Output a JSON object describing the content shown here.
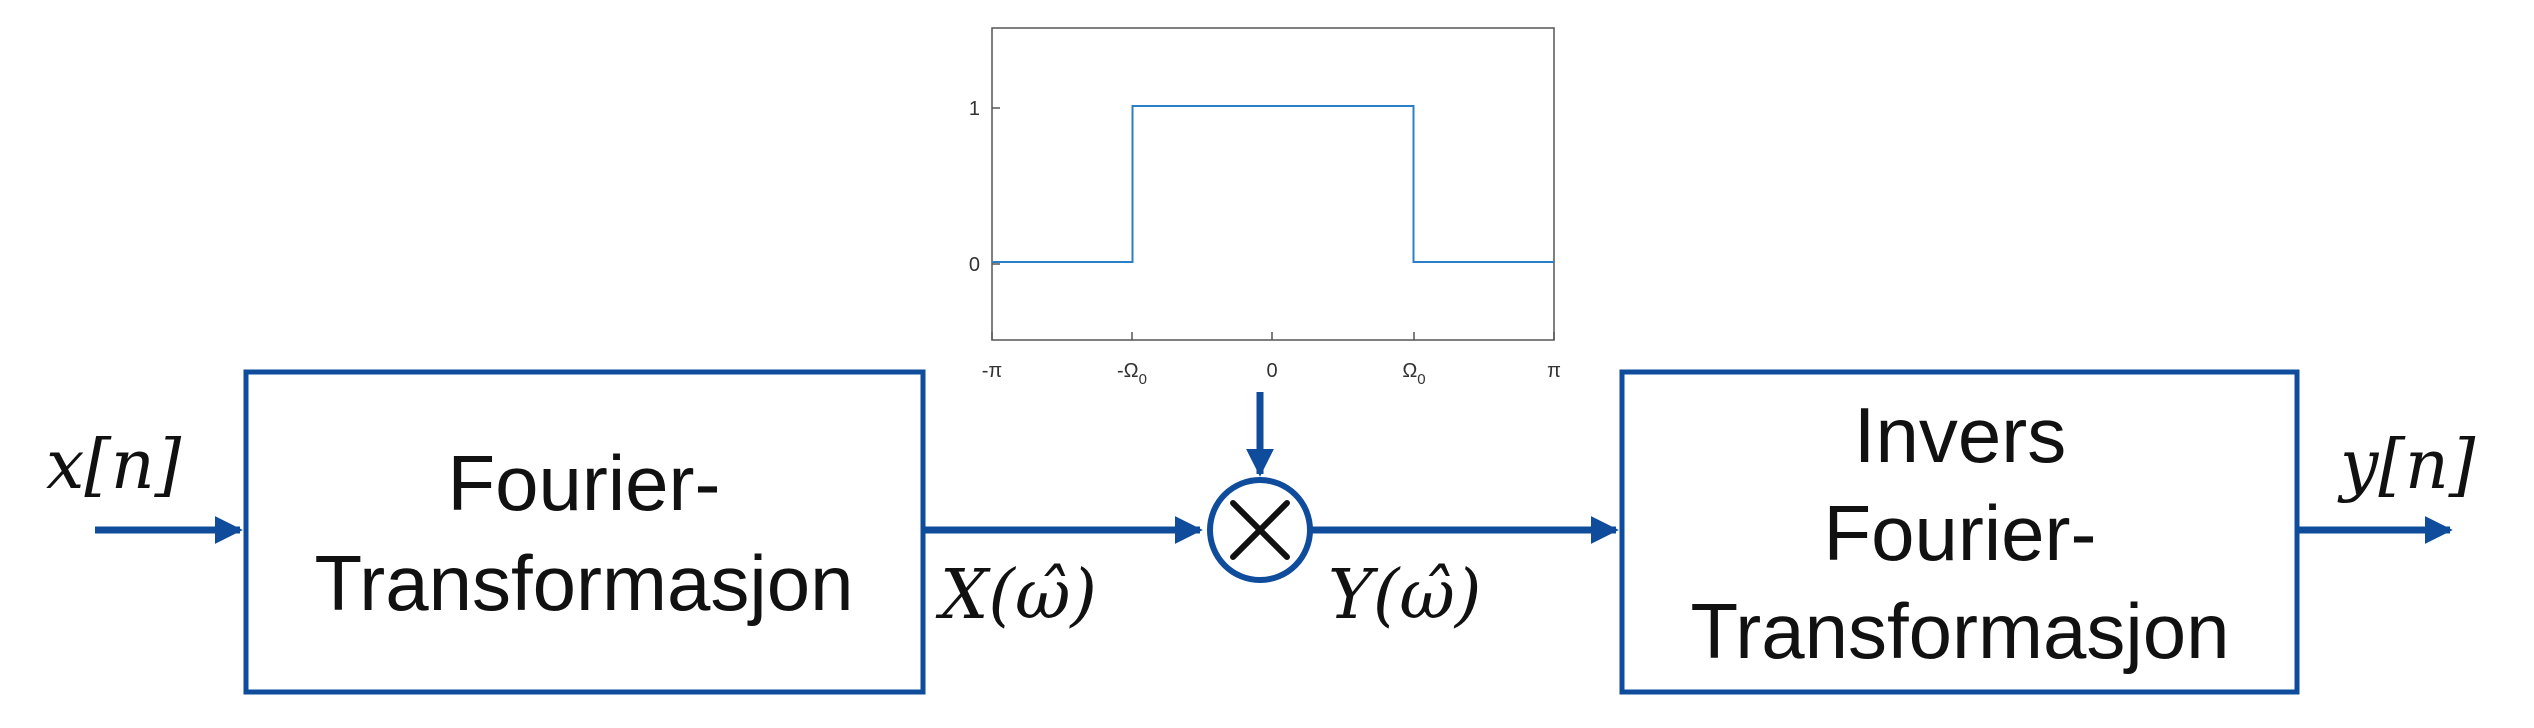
{
  "colors": {
    "line": "#0F4C9C",
    "plot_line": "#2C7FC6",
    "axis": "#555555",
    "text": "#111111"
  },
  "signals": {
    "input": "x[n]",
    "spectrum_in": "X(ω̂)",
    "spectrum_out": "Y(ω̂)",
    "output": "y[n]"
  },
  "blocks": {
    "fourier": {
      "line1": "Fourier-",
      "line2": "Transformasjon"
    },
    "inverse": {
      "line1": "Invers",
      "line2": "Fourier-",
      "line3": "Transformasjon"
    }
  },
  "multiplier_symbol": "multiply-x-icon",
  "chart_data": {
    "type": "line",
    "title": "",
    "xlabel": "",
    "ylabel": "",
    "x_ticks": [
      {
        "label": "-π",
        "base": "-π",
        "sub": ""
      },
      {
        "label": "-Ω0",
        "base": "-Ω",
        "sub": "0"
      },
      {
        "label": "0",
        "base": "0",
        "sub": ""
      },
      {
        "label": "Ω0",
        "base": "Ω",
        "sub": "0"
      },
      {
        "label": "π",
        "base": "π",
        "sub": ""
      }
    ],
    "y_ticks": [
      "0",
      "1"
    ],
    "ylim": [
      -0.5,
      1.5
    ],
    "series": [
      {
        "x": [
          -1,
          -0.5,
          -0.5,
          0.5,
          0.5,
          1
        ],
        "y": [
          0,
          0,
          1,
          1,
          0,
          0
        ]
      }
    ]
  }
}
